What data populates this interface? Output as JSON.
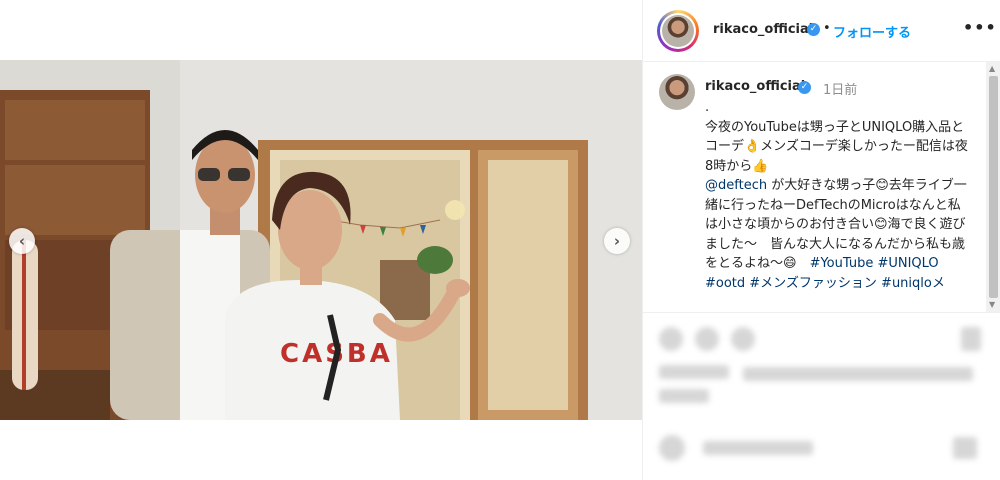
{
  "post": {
    "username": "rikaco_official",
    "follow_label": "フォローする",
    "dot_separator": "•",
    "more_label": "•••",
    "verified_symbol": "✓"
  },
  "caption": {
    "username": "rikaco_official",
    "time": "1日前",
    "lead": ".",
    "text_1": "今夜のYouTubeは甥っ子とUNIQLO購入品とコーデ👌メンズコーデ楽しかったー配信は夜8時から👍",
    "mention": "@deftech",
    "text_2": " が大好きな甥っ子😊去年ライブ一緒に行ったねーDefTechのMicroはなんと私は小さな頃からのお付き合い😊海で良く遊びました〜　皆んな大人になるんだから私も歳をとるよね〜😄　",
    "hashtags_1": "#YouTube #UNIQLO",
    "hashtags_2": "#ootd #メンズファッション #uniqloメ"
  },
  "media": {
    "prev_icon": "‹",
    "next_icon": "›",
    "shirt_print": "CASBA"
  },
  "colors": {
    "accent_blue": "#0095f6",
    "link": "#00376b",
    "verified": "#3897f0"
  }
}
